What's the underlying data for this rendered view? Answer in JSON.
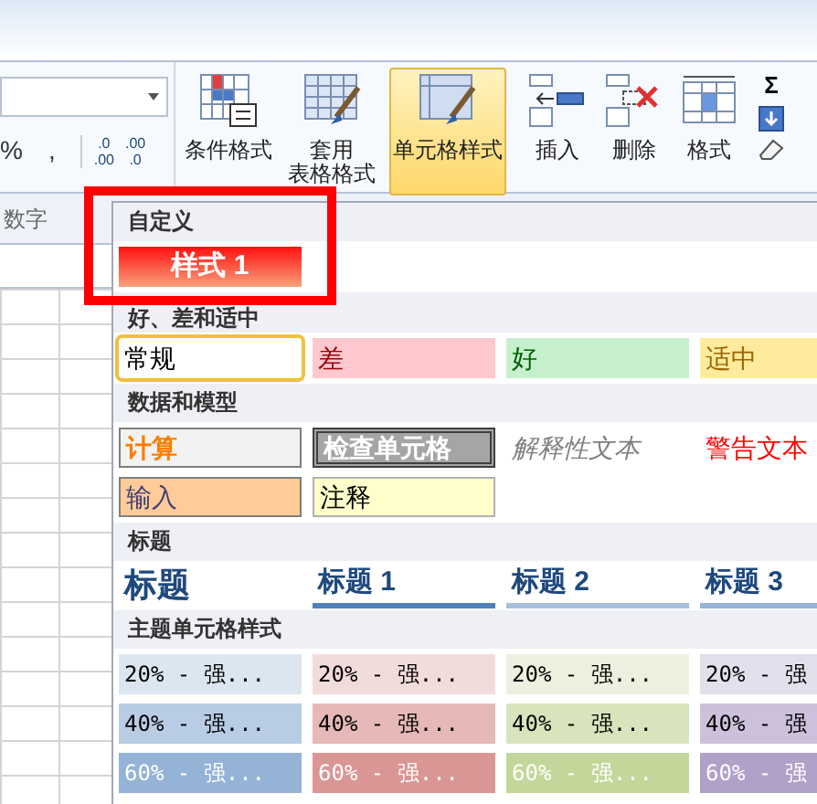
{
  "ribbon": {
    "number_symbols": [
      "%",
      ","
    ],
    "decimal_buttons": [
      {
        "top": ".0",
        "bottom": ".00"
      },
      {
        "top": ".00",
        "bottom": ".0"
      }
    ],
    "number_group_label": "数字",
    "buttons": [
      {
        "kind": "conditional",
        "lines": [
          "条件格式"
        ],
        "selected": false
      },
      {
        "kind": "table",
        "lines": [
          "套用",
          "表格格式"
        ],
        "selected": false
      },
      {
        "kind": "cellstyle",
        "lines": [
          "单元格样式"
        ],
        "selected": true
      },
      {
        "kind": "insert",
        "lines": [
          "插入"
        ],
        "selected": false
      },
      {
        "kind": "delete",
        "lines": [
          "删除"
        ],
        "selected": false
      },
      {
        "kind": "format",
        "lines": [
          "格式"
        ],
        "selected": false
      }
    ],
    "sum_symbol": "Σ"
  },
  "styles_panel": {
    "sections": [
      {
        "title": "自定义",
        "items": [
          {
            "label": "样式 1",
            "kind": "custom",
            "selected": false
          }
        ]
      },
      {
        "title": "好、差和适中",
        "items": [
          {
            "label": "常规",
            "kind": "normal",
            "selected": true
          },
          {
            "label": "差",
            "kind": "bad",
            "selected": false
          },
          {
            "label": "好",
            "kind": "good",
            "selected": false
          },
          {
            "label": "适中",
            "kind": "neutral",
            "selected": false
          }
        ]
      },
      {
        "title": "数据和模型",
        "items": [
          {
            "label": "计算",
            "kind": "calc",
            "selected": false
          },
          {
            "label": "检查单元格",
            "kind": "check",
            "selected": false
          },
          {
            "label": "解释性文本",
            "kind": "explanatory",
            "selected": false
          },
          {
            "label": "警告文本",
            "kind": "warning",
            "selected": false
          },
          {
            "label": "输入",
            "kind": "input",
            "selected": false
          },
          {
            "label": "注释",
            "kind": "note",
            "selected": false
          }
        ]
      },
      {
        "title": "标题",
        "items": [
          {
            "label": "标题",
            "kind": "title",
            "selected": false
          },
          {
            "label": "标题 1",
            "kind": "heading",
            "color": "#4f81bd",
            "selected": false
          },
          {
            "label": "标题 2",
            "kind": "heading",
            "color": "#a7bfde",
            "selected": false
          },
          {
            "label": "标题 3",
            "kind": "heading",
            "color": "#95b3d7",
            "selected": false
          }
        ]
      },
      {
        "title": "主题单元格样式",
        "items": [
          {
            "label": "20% - 强...",
            "kind": "accent_light",
            "color": "#dce6f1",
            "selected": false
          },
          {
            "label": "20% - 强...",
            "kind": "accent_light",
            "color": "#f2dcdb",
            "selected": false
          },
          {
            "label": "20% - 强...",
            "kind": "accent_light",
            "color": "#ebf1de",
            "selected": false
          },
          {
            "label": "20% - 强",
            "kind": "accent_light",
            "color": "#e4dfec",
            "selected": false
          },
          {
            "label": "40% - 强...",
            "kind": "accent_light",
            "color": "#b8cce4",
            "selected": false
          },
          {
            "label": "40% - 强...",
            "kind": "accent_light",
            "color": "#e6b8b7",
            "selected": false
          },
          {
            "label": "40% - 强...",
            "kind": "accent_light",
            "color": "#d8e4bc",
            "selected": false
          },
          {
            "label": "40% - 强",
            "kind": "accent_light",
            "color": "#ccc0da",
            "selected": false
          },
          {
            "label": "60% - 强...",
            "kind": "accent_dark",
            "color": "#95b3d7",
            "selected": false
          },
          {
            "label": "60% - 强...",
            "kind": "accent_dark",
            "color": "#da9694",
            "selected": false
          },
          {
            "label": "60% - 强...",
            "kind": "accent_dark",
            "color": "#c4d79b",
            "selected": false
          },
          {
            "label": "60% - 强",
            "kind": "accent_dark",
            "color": "#b1a0c7",
            "selected": false
          }
        ]
      }
    ]
  }
}
